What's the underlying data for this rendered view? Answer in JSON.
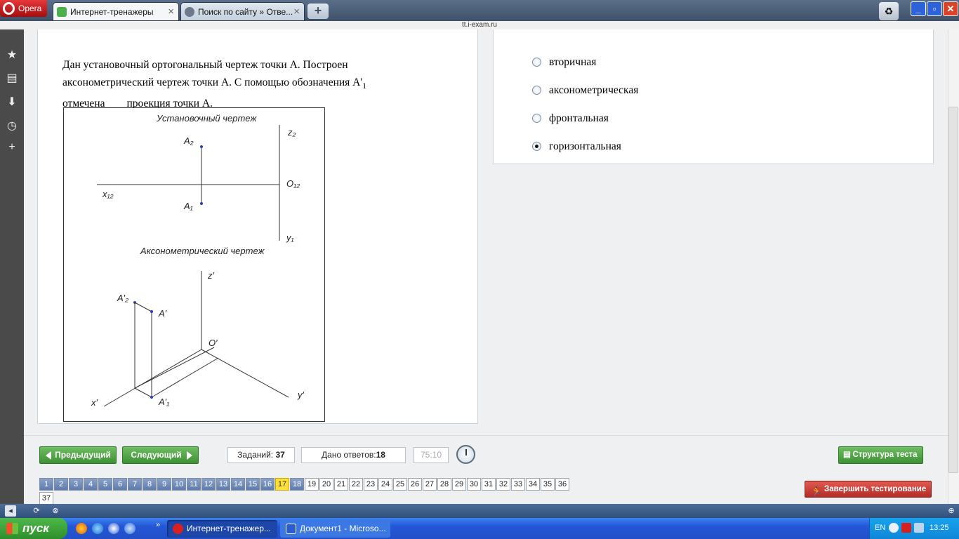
{
  "browser": {
    "menu_label": "Opera",
    "tabs": [
      {
        "label": "Интернет-тренажеры"
      },
      {
        "label": "Поиск по сайту » Отве..."
      }
    ],
    "new_tab": "+",
    "address": "tt.i-exam.ru"
  },
  "question": {
    "text_line1": "Дан установочный ортогональный чертеж точки A. Построен",
    "text_line2": "аксонометрический чертеж точки A. С помощью обозначения A'",
    "text_sub": "1",
    "text_line3": "отмечена ___ проекция точки A."
  },
  "figure": {
    "title_top": "Установочный чертеж",
    "title_bottom": "Аксонометрический чертеж",
    "labels": {
      "a2": "A₂",
      "a1": "A₁",
      "x12": "x₁₂",
      "o12": "O₁₂",
      "z2": "z₂",
      "y1": "y₁",
      "z_prime": "z′",
      "o_prime": "O′",
      "x_prime": "x′",
      "y_prime": "y′",
      "a_prime": "A′",
      "a2_prime": "A′₂",
      "a1_prime": "A′₁"
    }
  },
  "answers": [
    {
      "label": "вторичная",
      "selected": false
    },
    {
      "label": "аксонометрическая",
      "selected": false
    },
    {
      "label": "фронтальная",
      "selected": false
    },
    {
      "label": "горизонтальная",
      "selected": true
    }
  ],
  "nav": {
    "prev": "Предыдущий",
    "next": "Следующий",
    "tasks_label": "Заданий:",
    "tasks_value": "37",
    "answered_label": "Дано ответов:",
    "answered_value": "18",
    "timer": "75:10",
    "structure": "Структура теста",
    "finish": "Завершить тестирование",
    "current": 17,
    "answered_count": 18,
    "total": 37
  },
  "taskbar": {
    "start": "пуск",
    "tasks": [
      "Интернет-тренажер...",
      "Документ1 - Microso..."
    ],
    "lang": "EN",
    "time": "13:25"
  }
}
